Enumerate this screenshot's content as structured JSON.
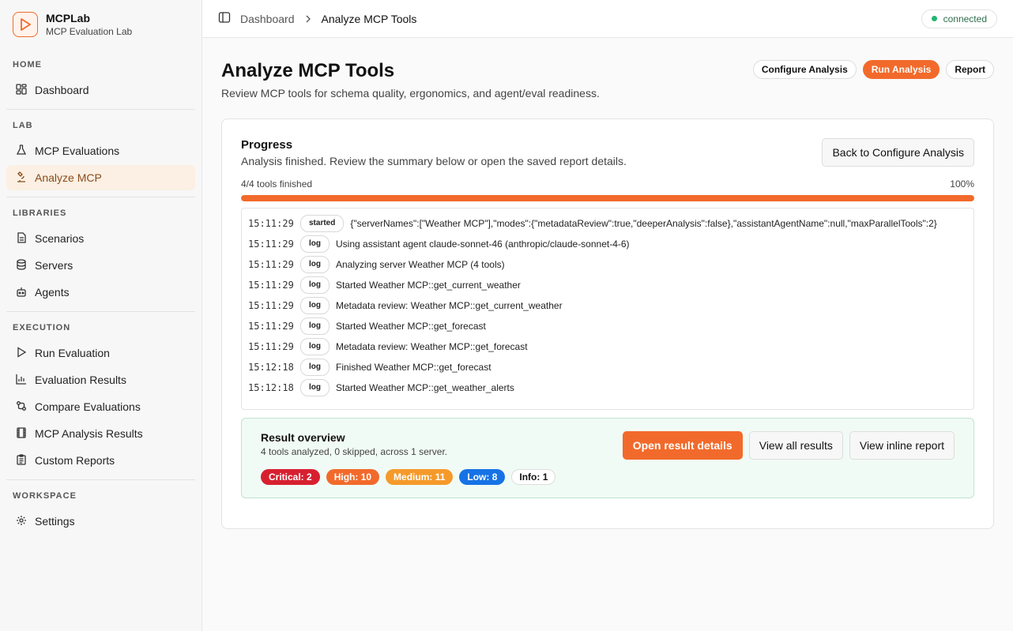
{
  "brand": {
    "name": "MCPLab",
    "subtitle": "MCP Evaluation Lab"
  },
  "sidebar": {
    "sections": [
      {
        "label": "HOME",
        "items": [
          {
            "label": "Dashboard",
            "icon": "dashboard-icon"
          }
        ]
      },
      {
        "label": "LAB",
        "items": [
          {
            "label": "MCP Evaluations",
            "icon": "flask-icon"
          },
          {
            "label": "Analyze MCP",
            "icon": "microscope-icon",
            "active": true
          }
        ]
      },
      {
        "label": "LIBRARIES",
        "items": [
          {
            "label": "Scenarios",
            "icon": "file-icon"
          },
          {
            "label": "Servers",
            "icon": "database-icon"
          },
          {
            "label": "Agents",
            "icon": "bot-icon"
          }
        ]
      },
      {
        "label": "EXECUTION",
        "items": [
          {
            "label": "Run Evaluation",
            "icon": "play-icon"
          },
          {
            "label": "Evaluation Results",
            "icon": "bar-chart-icon"
          },
          {
            "label": "Compare Evaluations",
            "icon": "compare-icon"
          },
          {
            "label": "MCP Analysis Results",
            "icon": "film-icon"
          },
          {
            "label": "Custom Reports",
            "icon": "clipboard-icon"
          }
        ]
      },
      {
        "label": "WORKSPACE",
        "items": [
          {
            "label": "Settings",
            "icon": "gear-icon"
          }
        ]
      }
    ]
  },
  "topbar": {
    "crumb_parent": "Dashboard",
    "crumb_current": "Analyze MCP Tools",
    "status": "connected"
  },
  "page": {
    "title": "Analyze MCP Tools",
    "description": "Review MCP tools for schema quality, ergonomics, and agent/eval readiness.",
    "actions": {
      "configure": "Configure Analysis",
      "run": "Run Analysis",
      "report": "Report"
    }
  },
  "progress": {
    "title": "Progress",
    "description": "Analysis finished. Review the summary below or open the saved report details.",
    "back_button": "Back to Configure Analysis",
    "tools_finished": "4/4 tools finished",
    "percent_label": "100%",
    "fraction": 1.0
  },
  "log": [
    {
      "time": "15:11:29",
      "tag": "started",
      "message": "{\"serverNames\":[\"Weather MCP\"],\"modes\":{\"metadataReview\":true,\"deeperAnalysis\":false},\"assistantAgentName\":null,\"maxParallelTools\":2}"
    },
    {
      "time": "15:11:29",
      "tag": "log",
      "message": "Using assistant agent claude-sonnet-46 (anthropic/claude-sonnet-4-6)"
    },
    {
      "time": "15:11:29",
      "tag": "log",
      "message": "Analyzing server Weather MCP (4 tools)"
    },
    {
      "time": "15:11:29",
      "tag": "log",
      "message": "Started Weather MCP::get_current_weather"
    },
    {
      "time": "15:11:29",
      "tag": "log",
      "message": "Metadata review: Weather MCP::get_current_weather"
    },
    {
      "time": "15:11:29",
      "tag": "log",
      "message": "Started Weather MCP::get_forecast"
    },
    {
      "time": "15:11:29",
      "tag": "log",
      "message": "Metadata review: Weather MCP::get_forecast"
    },
    {
      "time": "15:12:18",
      "tag": "log",
      "message": "Finished Weather MCP::get_forecast"
    },
    {
      "time": "15:12:18",
      "tag": "log",
      "message": "Started Weather MCP::get_weather_alerts"
    }
  ],
  "result": {
    "title": "Result overview",
    "description": "4 tools analyzed, 0 skipped, across 1 server.",
    "buttons": {
      "open": "Open result details",
      "all": "View all results",
      "inline": "View inline report"
    },
    "badges": [
      {
        "label": "Critical: 2",
        "color": "#d7202f"
      },
      {
        "label": "High: 10",
        "color": "#f26a2b"
      },
      {
        "label": "Medium: 11",
        "color": "#f59a2a"
      },
      {
        "label": "Low: 8",
        "color": "#1673e6"
      },
      {
        "label": "Info: 1",
        "color": "#ffffff"
      }
    ]
  },
  "colors": {
    "accent": "#f26a2b",
    "status_ok": "#22b573"
  }
}
